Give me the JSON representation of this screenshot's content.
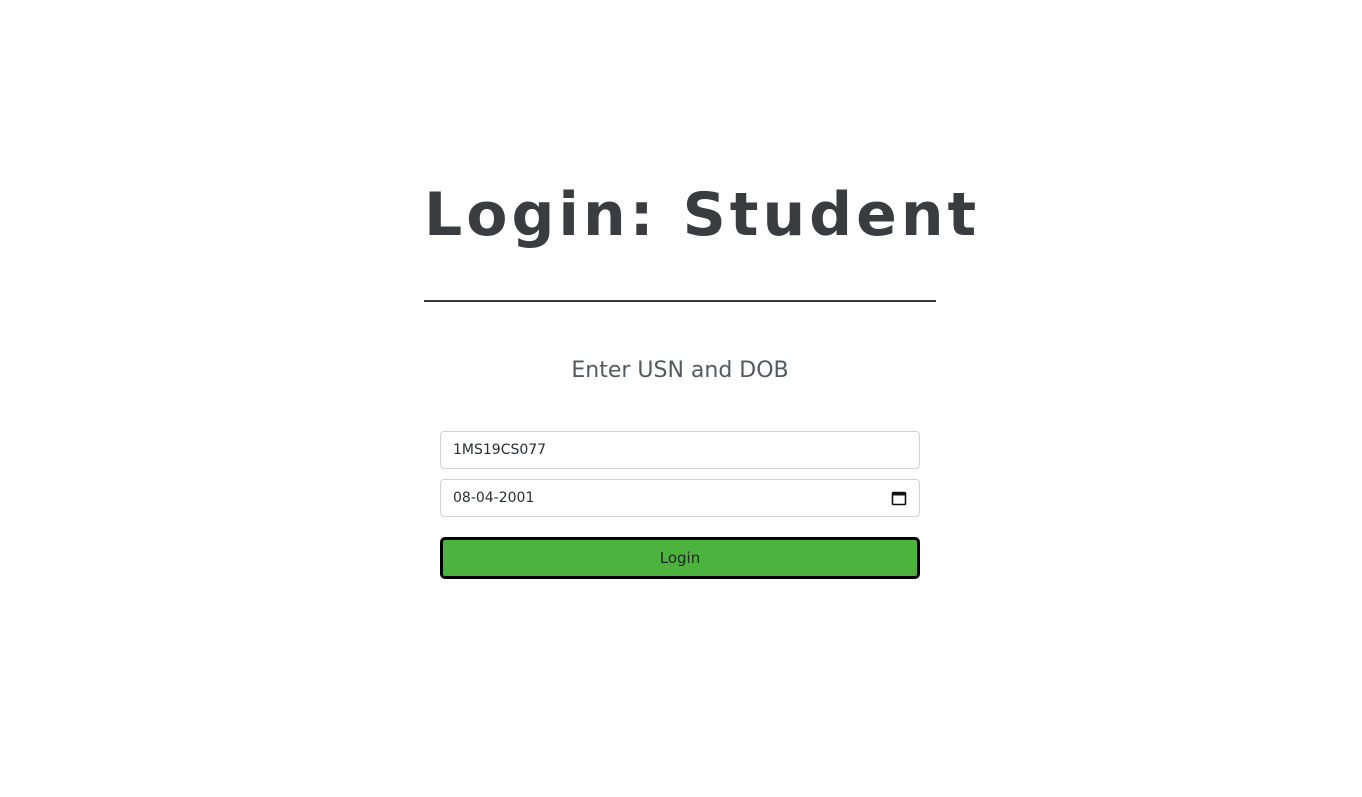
{
  "header": {
    "title": "Login: Student"
  },
  "form": {
    "instruction": "Enter USN and DOB",
    "usn_value": "1MS19CS077",
    "dob_value": "08-04-2001",
    "dob_icon": "calendar-icon",
    "submit_label": "Login"
  },
  "colors": {
    "title": "#3b3c40",
    "button_bg": "#4bb33e",
    "button_border": "#000000"
  }
}
